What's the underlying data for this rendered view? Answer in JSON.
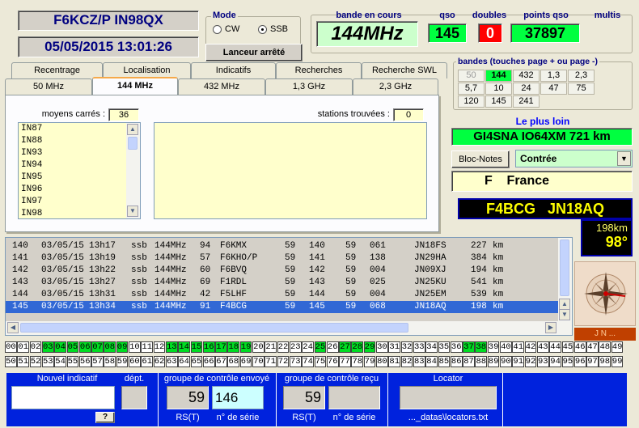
{
  "header": {
    "callsign_locator": "F6KCZ/P  IN98QX",
    "datetime": "05/05/2015  13:01:26"
  },
  "mode": {
    "title": "Mode",
    "options": [
      "CW",
      "SSB"
    ],
    "selected": "SSB",
    "status_button": "Lanceur arrêté"
  },
  "current_band": {
    "label": "bande en cours",
    "value": "144MHz"
  },
  "stats": {
    "qso_label": "qso",
    "qso_value": "145",
    "doubles_label": "doubles",
    "doubles_value": "0",
    "points_label": "points qso",
    "points_value": "37897",
    "multis_label": "multis",
    "colors": {
      "qso": "#00ff40",
      "doubles": "#ff0000",
      "points": "#00ff40"
    }
  },
  "bands_panel": {
    "title": "bandes (touches page + ou page -)",
    "rows": [
      [
        "50",
        "144",
        "432",
        "1,3",
        "2,3"
      ],
      [
        "5,7",
        "10",
        "24",
        "47",
        "75"
      ],
      [
        "120",
        "145",
        "241"
      ]
    ],
    "active": "144"
  },
  "tabs_top": [
    "Recentrage",
    "Localisation",
    "Indicatifs",
    "Recherches",
    "Recherche SWL"
  ],
  "tabs_bottom": [
    "50 MHz",
    "144 MHz",
    "432 MHz",
    "1,3 GHz",
    "2,3 GHz"
  ],
  "tab_selected": "144 MHz",
  "squares": {
    "label": "moyens carrés :",
    "count": "36",
    "items": [
      "IN87",
      "IN88",
      "IN93",
      "IN94",
      "IN95",
      "IN96",
      "IN97",
      "IN98"
    ]
  },
  "stations": {
    "label": "stations trouvées :",
    "count": "0"
  },
  "farthest": {
    "title": "Le plus loin",
    "value": "GI4SNA IO64XM  721 km"
  },
  "notes_button": "Bloc-Notes",
  "country_select": "Contrée",
  "country": "F    France",
  "last_station": {
    "callsign": "F4BCG",
    "locator": "JN18AQ",
    "distance": "198km",
    "azimuth": "98°"
  },
  "compass_label": "J N ...",
  "log": {
    "rows": [
      [
        "140",
        "03/05/15",
        "13h17",
        "ssb",
        "144MHz",
        "94",
        "F6KMX",
        "59",
        "140",
        "59",
        "061",
        "JN18FS",
        "227",
        "km"
      ],
      [
        "141",
        "03/05/15",
        "13h19",
        "ssb",
        "144MHz",
        "57",
        "F6KHO/P",
        "59",
        "141",
        "59",
        "138",
        "JN29HA",
        "384",
        "km"
      ],
      [
        "142",
        "03/05/15",
        "13h22",
        "ssb",
        "144MHz",
        "60",
        "F6BVQ",
        "59",
        "142",
        "59",
        "004",
        "JN09XJ",
        "194",
        "km"
      ],
      [
        "143",
        "03/05/15",
        "13h27",
        "ssb",
        "144MHz",
        "69",
        "F1RDL",
        "59",
        "143",
        "59",
        "025",
        "JN25KU",
        "541",
        "km"
      ],
      [
        "144",
        "03/05/15",
        "13h31",
        "ssb",
        "144MHz",
        "42",
        "F5LHF",
        "59",
        "144",
        "59",
        "004",
        "JN25EM",
        "539",
        "km"
      ],
      [
        "145",
        "03/05/15",
        "13h34",
        "ssb",
        "144MHz",
        "91",
        "F4BCG",
        "59",
        "145",
        "59",
        "068",
        "JN18AQ",
        "198",
        "km"
      ]
    ],
    "selected_row": "145"
  },
  "departments_worked": [
    "03",
    "04",
    "05",
    "06",
    "07",
    "08",
    "09",
    "13",
    "14",
    "15",
    "16",
    "17",
    "18",
    "19",
    "25",
    "27",
    "28",
    "29",
    "37",
    "38"
  ],
  "entry": {
    "new_call_label": "Nouvel indicatif",
    "new_call_value": "",
    "dept_label": "dépt.",
    "help_button": "?",
    "sent_label": "groupe de contrôle envoyé",
    "sent_rst": "59",
    "sent_serial": "146",
    "recv_label": "groupe de contrôle reçu",
    "recv_rst": "59",
    "recv_serial": "",
    "rst_label": "RS(T)",
    "serial_label": "n° de série",
    "locator_label": "Locator",
    "locator_file": "..._datas\\locators.txt"
  }
}
